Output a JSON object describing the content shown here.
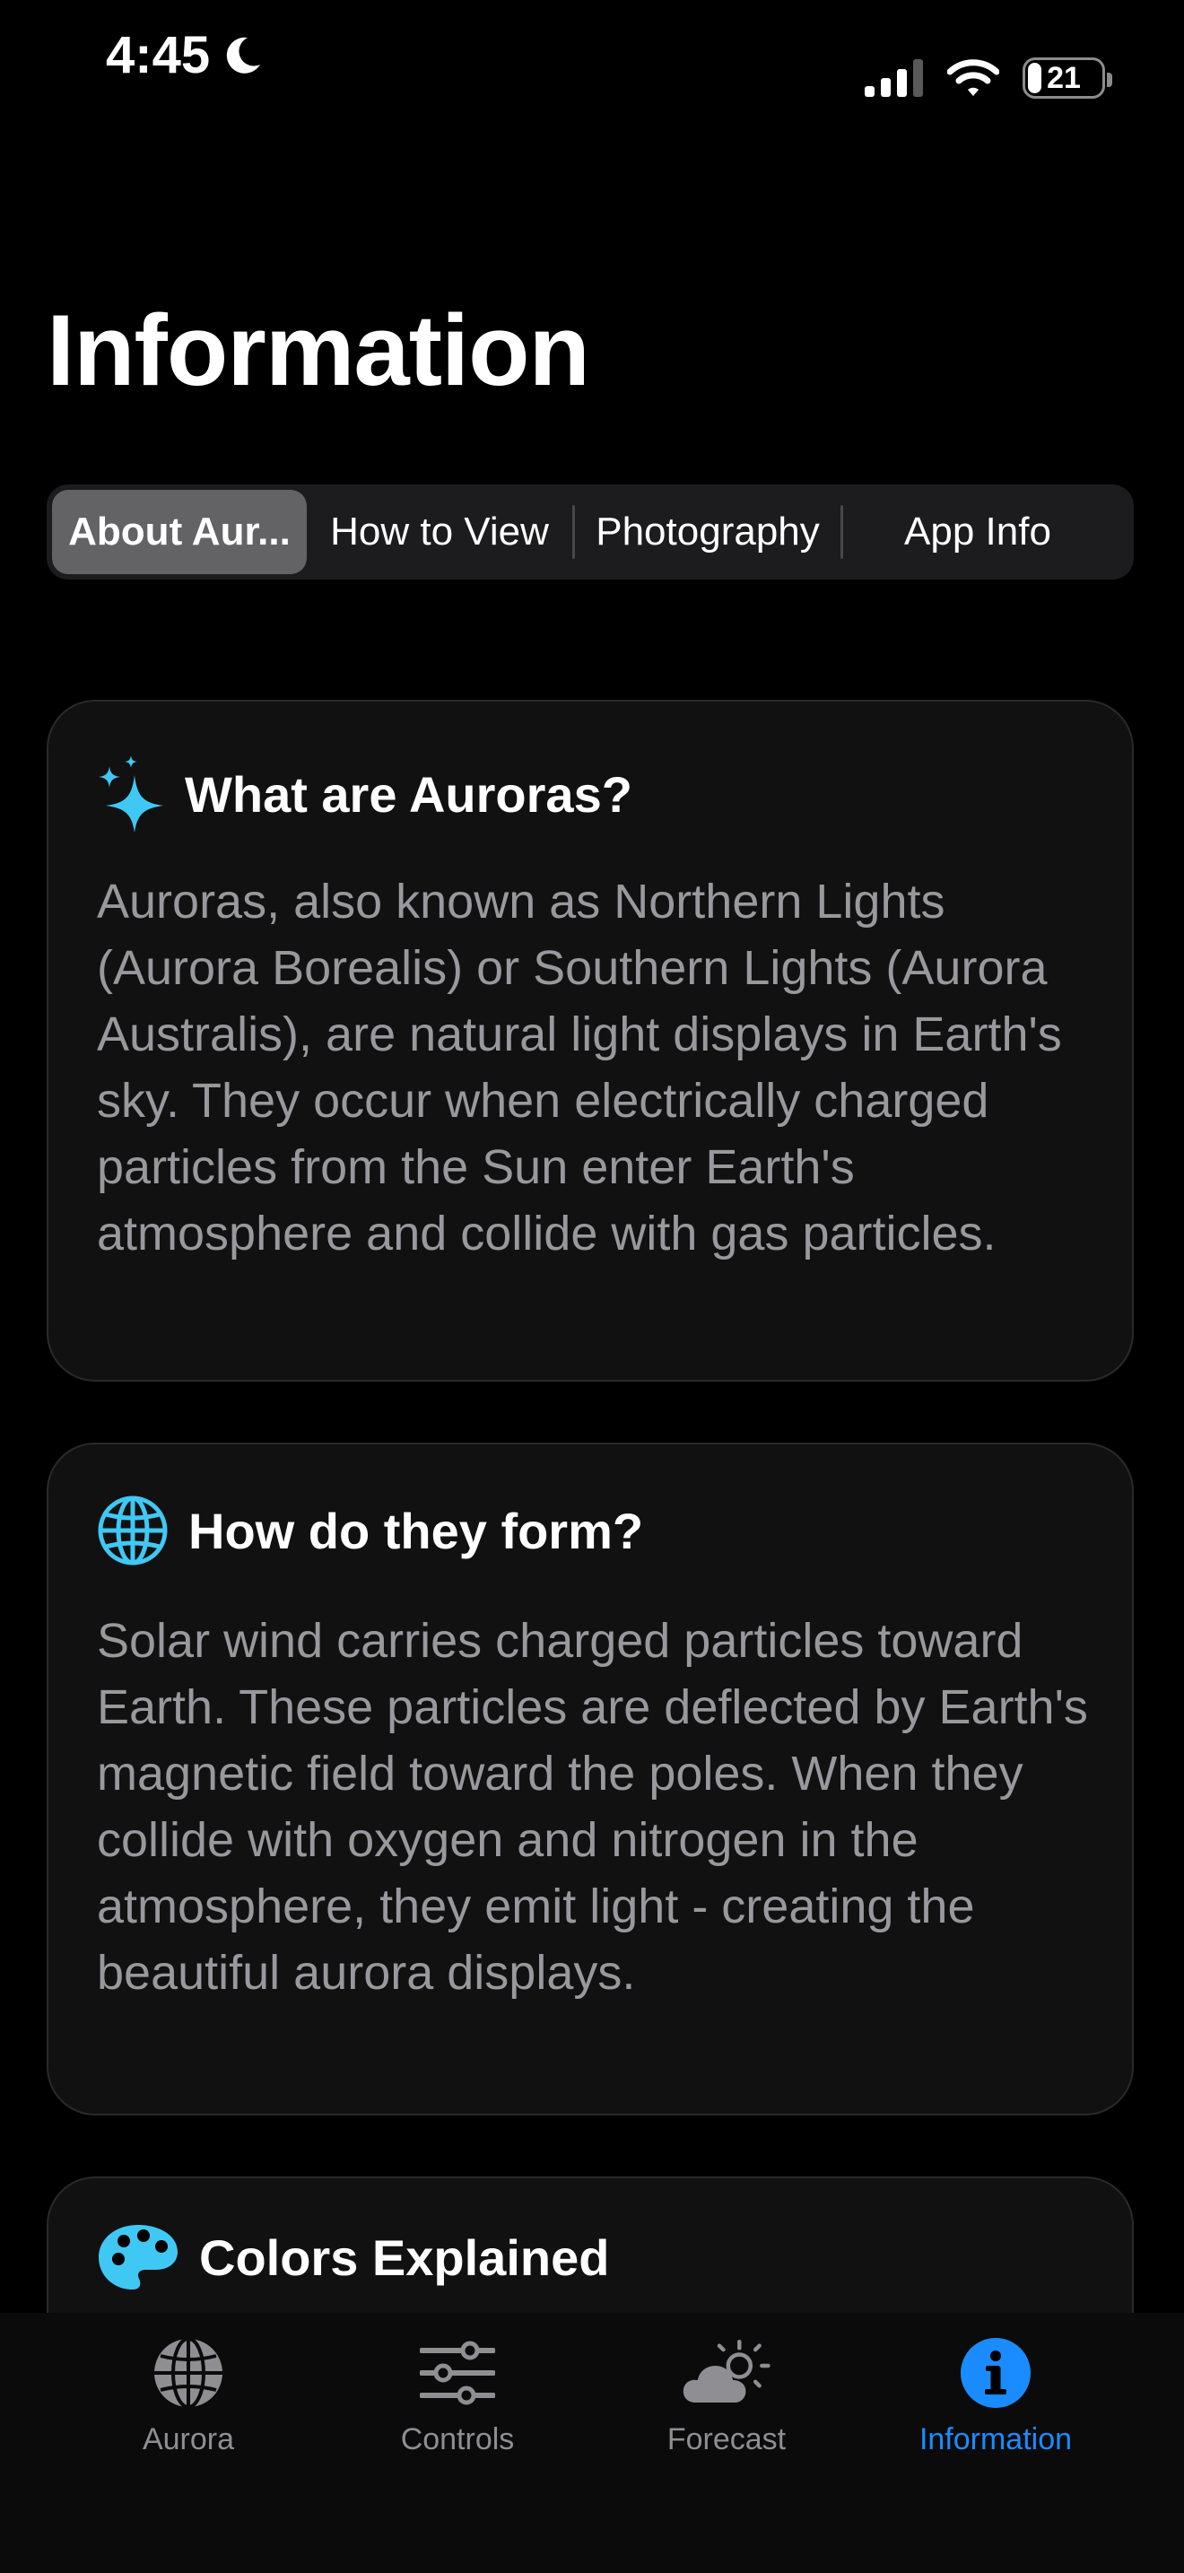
{
  "status": {
    "time": "4:45",
    "battery": "21"
  },
  "page": {
    "title": "Information"
  },
  "segments": [
    "About Aur...",
    "How to View",
    "Photography",
    "App Info"
  ],
  "cards": [
    {
      "title": "What are Auroras?",
      "icon": "sparkles-icon",
      "body": "Auroras, also known as Northern Lights (Aurora Borealis) or Southern Lights (Aurora Australis), are natural light displays in Earth's sky. They occur when electrically charged particles from the Sun enter Earth's atmosphere and collide with gas particles."
    },
    {
      "title": "How do they form?",
      "icon": "globe-icon",
      "body": "Solar wind carries charged particles toward Earth. These particles are deflected by Earth's magnetic field toward the poles. When they collide with oxygen and nitrogen in the atmosphere, they emit light - creating the beautiful aurora displays."
    },
    {
      "title": "Colors Explained",
      "icon": "palette-icon"
    }
  ],
  "tabs": [
    {
      "label": "Aurora",
      "icon": "globe-icon"
    },
    {
      "label": "Controls",
      "icon": "sliders-icon"
    },
    {
      "label": "Forecast",
      "icon": "cloud-sun-icon"
    },
    {
      "label": "Information",
      "icon": "info-icon"
    }
  ],
  "colors": {
    "accent": "#1a8cff",
    "icon_cyan": "#40c8f4",
    "card_bg": "#111112",
    "segment_active": "#636366"
  }
}
